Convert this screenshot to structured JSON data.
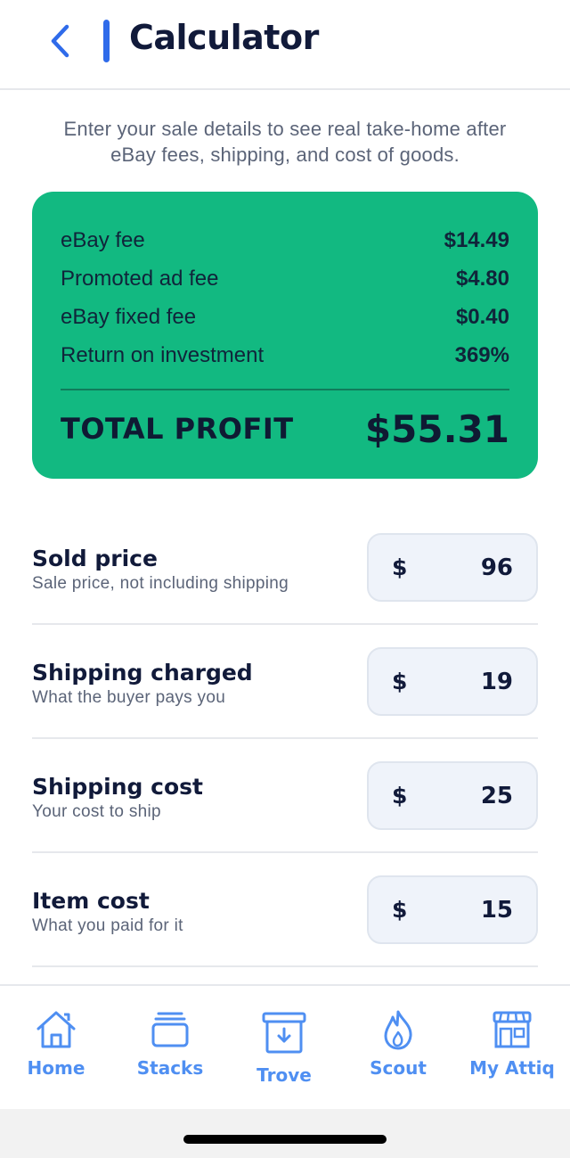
{
  "header": {
    "title": "Calculator",
    "back_icon": "chevron-left-icon"
  },
  "intro": {
    "line1": "Enter your sale details to see real take-home after",
    "line2": "eBay fees, shipping, and cost of goods."
  },
  "summary": {
    "rows": [
      {
        "label": "eBay fee",
        "value": "$14.49"
      },
      {
        "label": "Promoted ad fee",
        "value": "$4.80"
      },
      {
        "label": "eBay fixed fee",
        "value": "$0.40"
      },
      {
        "label": "Return on investment",
        "value": "369%"
      }
    ],
    "total_label": "TOTAL PROFIT",
    "total_value": "$55.31"
  },
  "inputs": [
    {
      "title": "Sold price",
      "subtitle": "Sale price, not including shipping",
      "currency": "$",
      "value": "96"
    },
    {
      "title": "Shipping charged",
      "subtitle": "What the buyer pays you",
      "currency": "$",
      "value": "19"
    },
    {
      "title": "Shipping cost",
      "subtitle": "Your cost to ship",
      "currency": "$",
      "value": "25"
    },
    {
      "title": "Item cost",
      "subtitle": "What you paid for it",
      "currency": "$",
      "value": "15"
    }
  ],
  "tabbar": {
    "tabs": [
      {
        "label": "Home",
        "icon": "house-icon"
      },
      {
        "label": "Stacks",
        "icon": "stack-icon"
      },
      {
        "label": "Trove",
        "icon": "archive-icon"
      },
      {
        "label": "Scout",
        "icon": "flame-icon"
      },
      {
        "label": "My Attiq",
        "icon": "storefront-icon"
      }
    ]
  },
  "colors": {
    "accent": "#2f6bea",
    "card_green": "#12b981",
    "tab_blue": "#4f8ff2",
    "text_dark": "#111a3a"
  }
}
